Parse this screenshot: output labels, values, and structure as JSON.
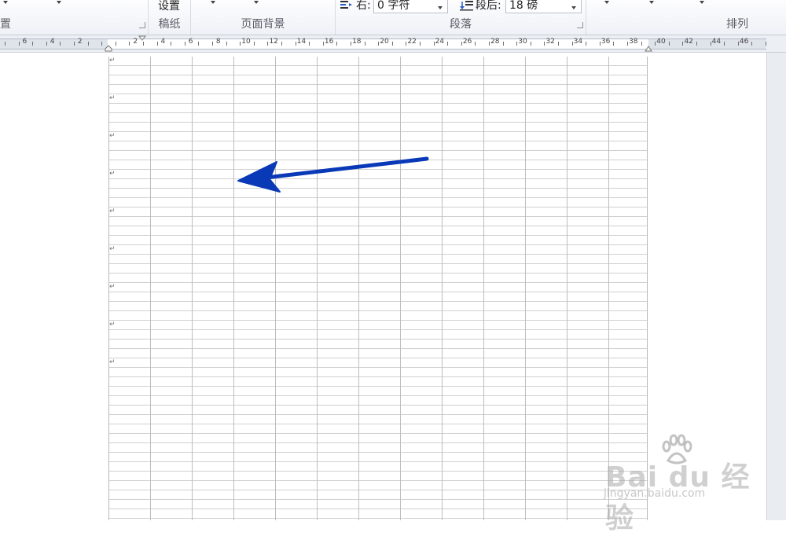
{
  "ribbon": {
    "groups": {
      "page_setup": {
        "label": "置"
      },
      "manuscript": {
        "label": "稿纸",
        "button": "设置"
      },
      "page_background": {
        "label": "页面背景"
      },
      "paragraph": {
        "label": "段落",
        "indent_right_label": "右:",
        "indent_right_value": "0 字符",
        "spacing_after_label": "段后:",
        "spacing_after_value": "18 磅"
      },
      "arrange": {
        "label": "排列"
      }
    }
  },
  "ruler": {
    "numbers": [
      "6",
      "4",
      "2",
      "2",
      "4",
      "6",
      "8",
      "10",
      "12",
      "14",
      "16",
      "18",
      "20",
      "22",
      "24",
      "26",
      "28",
      "30",
      "32",
      "34",
      "36",
      "38",
      "40",
      "42",
      "44",
      "46"
    ]
  },
  "document": {
    "paragraph_mark": "↵"
  },
  "annotation": {
    "arrow_color": "#0a39b8"
  },
  "watermark": {
    "brand": "Bai du 经验",
    "url": "jingyan.baidu.com"
  }
}
